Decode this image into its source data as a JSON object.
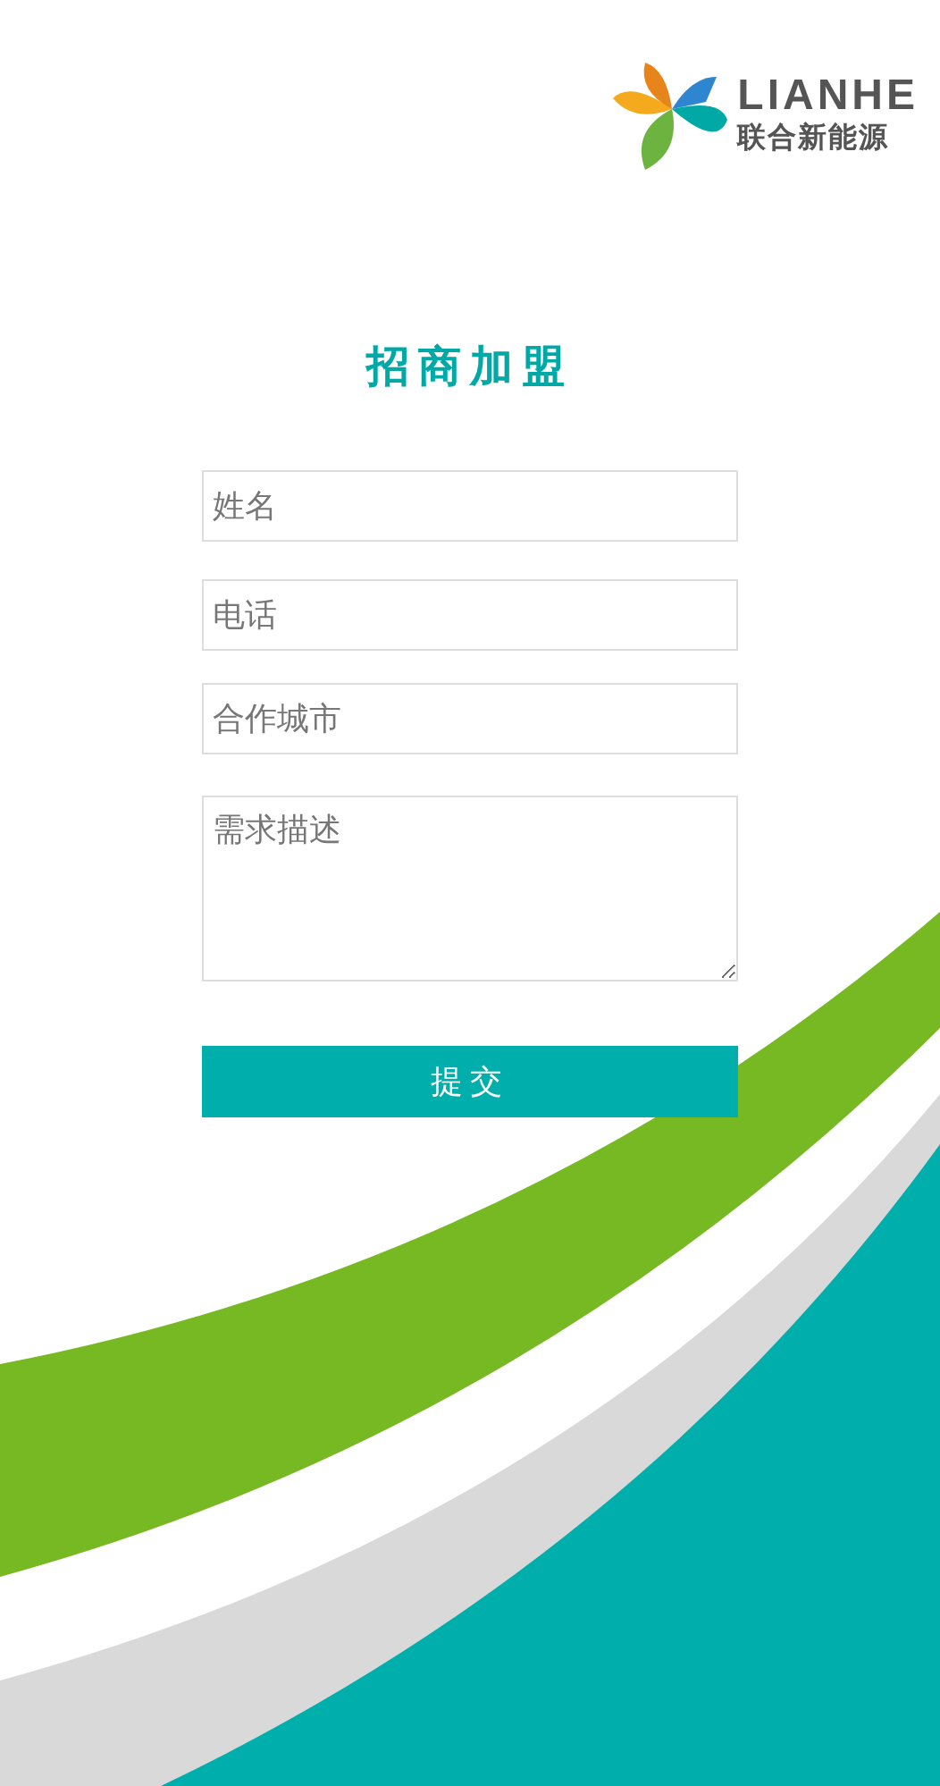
{
  "logo": {
    "wordmark": "LIANHE",
    "name": "联合新能源"
  },
  "title": "招商加盟",
  "form": {
    "fields": [
      {
        "kind": "input",
        "placeholder": "姓名"
      },
      {
        "kind": "input",
        "placeholder": "电话"
      },
      {
        "kind": "input",
        "placeholder": "合作城市"
      },
      {
        "kind": "textarea",
        "placeholder": "需求描述"
      }
    ],
    "submit": "提交"
  }
}
